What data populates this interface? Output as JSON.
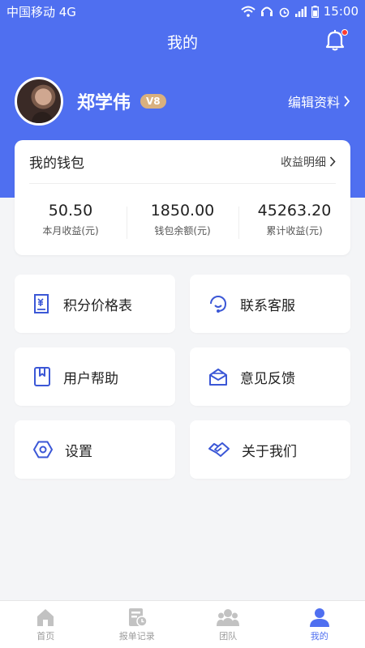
{
  "status_bar": {
    "carrier": "中国移动 4G",
    "time": "15:00"
  },
  "header": {
    "title": "我的"
  },
  "profile": {
    "name": "郑学伟",
    "level_badge": "V8",
    "edit_label": "编辑资料"
  },
  "wallet": {
    "title": "我的钱包",
    "detail_link": "收益明细",
    "stats": [
      {
        "value": "50.50",
        "label": "本月收益(元)"
      },
      {
        "value": "1850.00",
        "label": "钱包余额(元)"
      },
      {
        "value": "45263.20",
        "label": "累计收益(元)"
      }
    ]
  },
  "menu": [
    {
      "label": "积分价格表",
      "icon": "price-list-icon"
    },
    {
      "label": "联系客服",
      "icon": "customer-service-icon"
    },
    {
      "label": "用户帮助",
      "icon": "help-book-icon"
    },
    {
      "label": "意见反馈",
      "icon": "feedback-icon"
    },
    {
      "label": "设置",
      "icon": "settings-icon"
    },
    {
      "label": "关于我们",
      "icon": "handshake-icon"
    }
  ],
  "tabbar": {
    "items": [
      {
        "label": "首页",
        "icon": "home-icon"
      },
      {
        "label": "报单记录",
        "icon": "records-icon"
      },
      {
        "label": "团队",
        "icon": "team-icon"
      },
      {
        "label": "我的",
        "icon": "profile-icon"
      }
    ],
    "active_index": 3
  },
  "colors": {
    "primary": "#4f6ff0",
    "vip_badge": "#d9b07e",
    "notification_dot": "#ff3b30",
    "background": "#f4f5f7"
  }
}
